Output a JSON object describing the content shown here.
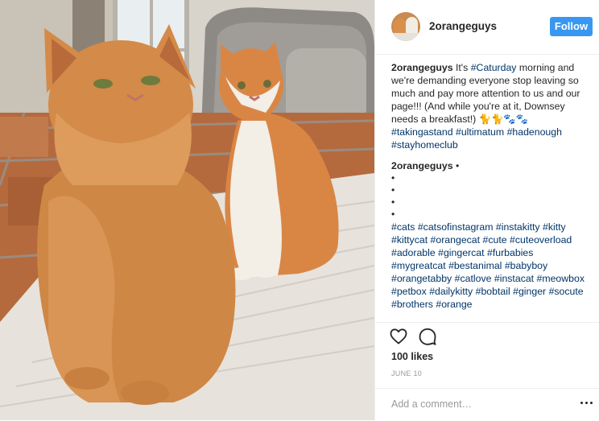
{
  "post": {
    "username": "2orangeguys",
    "follow_label": "Follow"
  },
  "caption": {
    "username": "2orangeguys",
    "text_start": "It's ",
    "hashtag_caturday": "#Caturday",
    "text_body": " morning and we're demanding everyone stop leaving so much and pay more attention to us and our page!!! (And while you're at it, Downsey needs a breakfast!) 🐈🐈🐾🐾",
    "tags": [
      "#takingastand",
      "#ultimatum",
      "#hadenough",
      "#stayhomeclub"
    ]
  },
  "comment": {
    "username": "2orangeguys",
    "separator": "•",
    "bullets": [
      "•",
      "•",
      "•",
      "•"
    ],
    "tags": [
      "#cats",
      "#catsofinstagram",
      "#instakitty",
      "#kitty",
      "#kittycat",
      "#orangecat",
      "#cute",
      "#cuteoverload",
      "#adorable",
      "#gingercat",
      "#furbabies",
      "#mygreatcat",
      "#bestanimal",
      "#babyboy",
      "#orangetabby",
      "#catlove",
      "#instacat",
      "#meowbox",
      "#petbox",
      "#dailykitty",
      "#bobtail",
      "#ginger",
      "#socute",
      "#brothers",
      "#orange"
    ]
  },
  "stats": {
    "likes": "100 likes",
    "date": "JUNE 10"
  },
  "add_comment": {
    "placeholder": "Add a comment…"
  },
  "icons": {
    "like": "heart-icon",
    "comment": "comment-bubble-icon",
    "more": "more-options-icon"
  },
  "colors": {
    "follow_button": "#3897f0",
    "hashtag": "#003569",
    "date": "#999999"
  }
}
